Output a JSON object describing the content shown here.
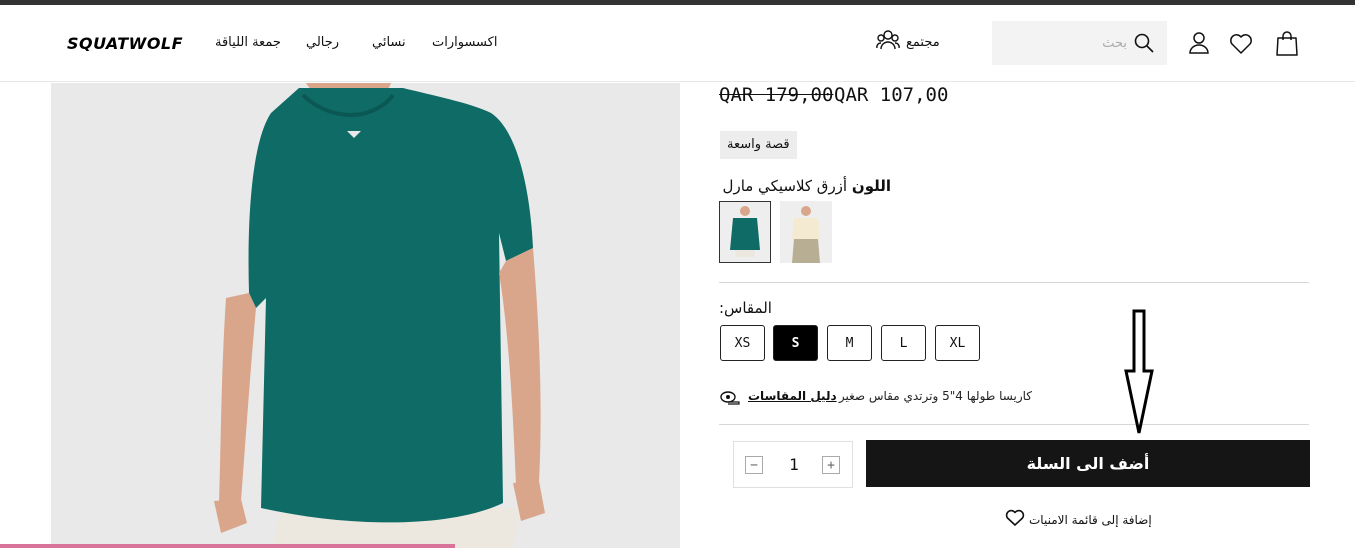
{
  "header": {
    "logo": "SQUATWOLF",
    "nav": [
      {
        "label": "جمعة اللياقة"
      },
      {
        "label": "رجالي"
      },
      {
        "label": "نسائي"
      },
      {
        "label": "اكسسوارات"
      }
    ],
    "community_label": "مجتمع",
    "search_placeholder": "بحث",
    "icons": [
      "search-icon",
      "user-icon",
      "heart-icon",
      "bag-icon",
      "community-icon"
    ]
  },
  "product": {
    "price_old": "QAR 179,00",
    "price_new": "QAR 107,00",
    "fit_badge": "قصة واسعة",
    "color_title": "اللون",
    "color_value": "أزرق كلاسيكي مارل",
    "swatches": [
      {
        "name": "teal",
        "selected": true,
        "color": "#0f6b66"
      },
      {
        "name": "cream",
        "selected": false,
        "color": "#f4ead2"
      }
    ],
    "size_label": "المقاس:",
    "sizes": [
      "XS",
      "S",
      "M",
      "L",
      "XL"
    ],
    "selected_size": "S",
    "model_note": "كاريسا طولها 4\"5 وترتدي مقاس صغير",
    "size_guide": "دليل المقاسات",
    "quantity": "1",
    "add_to_cart": "أضف الى السلة",
    "wishlist": "إضافة إلى قائمة الامنيات"
  },
  "colors": {
    "accent_dark": "#151515",
    "product_teal": "#0f6b66",
    "pink_progress": "#d9739a"
  }
}
